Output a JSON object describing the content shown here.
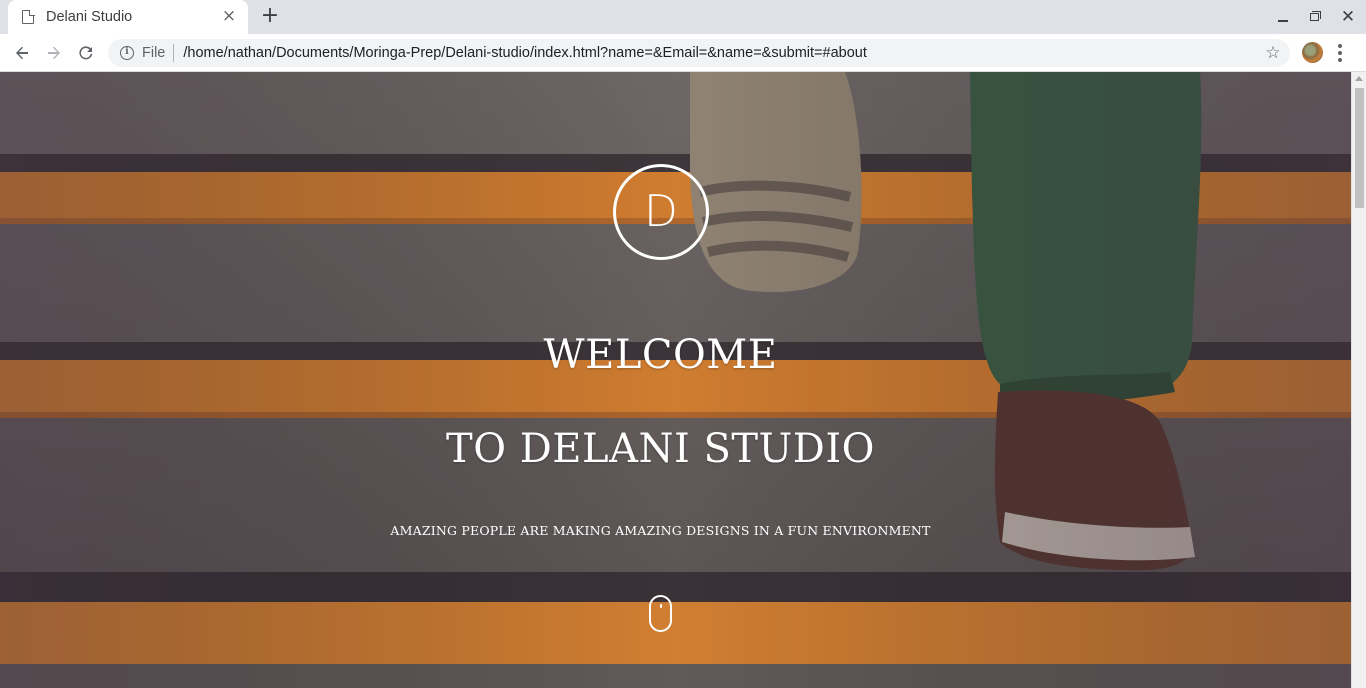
{
  "browser": {
    "tab_title": "Delani Studio",
    "tab_close": "×",
    "new_tab": "+",
    "scheme_label": "File",
    "url": "/home/nathan/Documents/Moringa-Prep/Delani-studio/index.html?name=&Email=&name=&submit=#about",
    "star": "☆",
    "close_window": "✕",
    "info_glyph": "i"
  },
  "icons": {
    "tab": "page-icon",
    "back": "arrow-left-icon",
    "forward": "arrow-right-icon",
    "reload": "reload-icon",
    "info": "info-icon",
    "bookmark": "star-icon",
    "profile": "avatar",
    "menu": "kebab-menu-icon",
    "scroll_cue": "mouse-icon"
  },
  "hero": {
    "logo_letter": "D",
    "welcome": "WELCOME",
    "studio": "TO DELANI STUDIO",
    "tagline": "AMAZING PEOPLE ARE MAKING AMAZING DESIGNS IN A FUN ENVIRONMENT"
  },
  "colors": {
    "stair_stripe": "#f0902e",
    "stair_gray": "#6f6c66",
    "text": "#ffffff",
    "omnibox": "#f1f3f4",
    "tabstrip": "#dee1e6"
  }
}
